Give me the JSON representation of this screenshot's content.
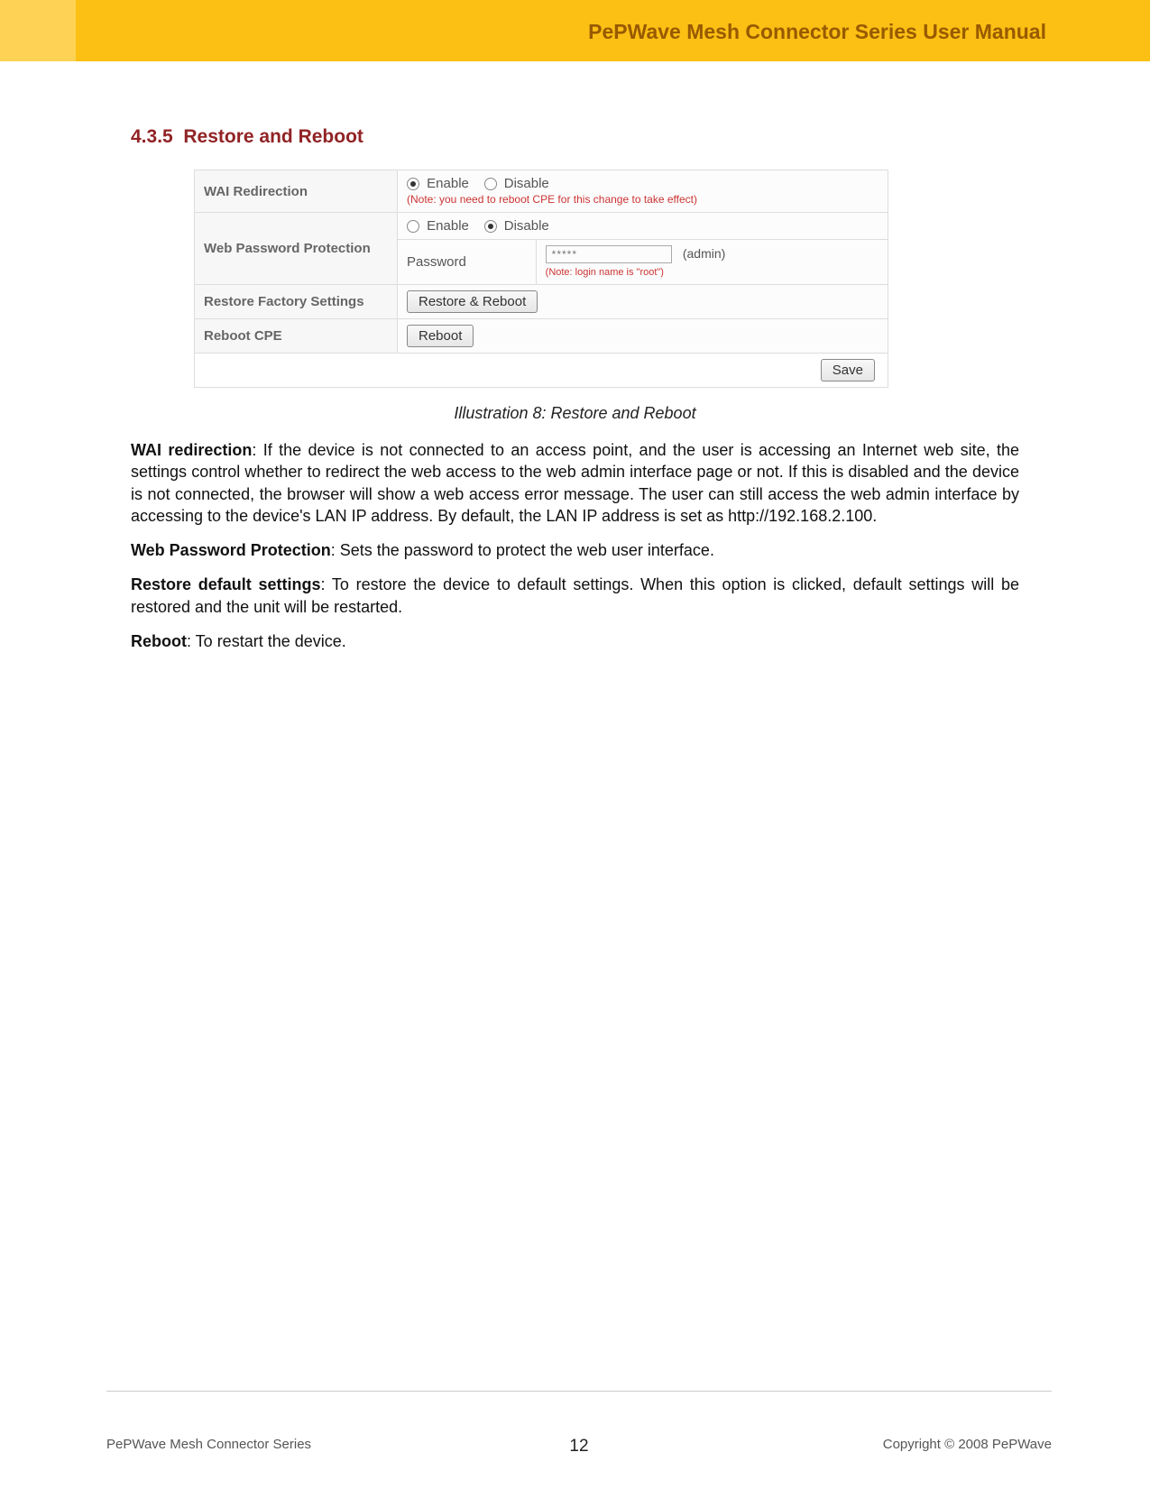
{
  "header": {
    "title": "PePWave Mesh Connector Series User Manual"
  },
  "section": {
    "number": "4.3.5",
    "title": "Restore and Reboot"
  },
  "table": {
    "wai_label": "WAI Redirection",
    "enable": "Enable",
    "disable": "Disable",
    "wai_note": "(Note: you need to reboot CPE for this change to take effect)",
    "webpw_label": "Web Password Protection",
    "password_label": "Password",
    "password_value": "*****",
    "admin_hint": "(admin)",
    "login_note": "(Note: login name is \"root\")",
    "restore_label": "Restore Factory Settings",
    "restore_btn": "Restore & Reboot",
    "reboot_label": "Reboot CPE",
    "reboot_btn": "Reboot",
    "save_btn": "Save"
  },
  "caption": "Illustration 8: Restore and Reboot",
  "paragraphs": {
    "p1_b": "WAI redirection",
    "p1": ": If the device is not connected to an access point, and the user is accessing an Internet web site, the settings control whether to redirect the web access to the web admin interface page or not.  If this is disabled and the device is not connected, the browser will show a web access error message.  The user can still access the web admin interface by accessing to the device's LAN IP address.  By default, the LAN IP address is set as http://192.168.2.100.",
    "p2_b": "Web Password Protection",
    "p2": ":  Sets the password to protect the web user interface.",
    "p3_b": "Restore default settings",
    "p3": ": To restore the device to default settings.  When this option is clicked, default settings will be restored and the unit will be restarted.",
    "p4_b": "Reboot",
    "p4": ": To restart the device."
  },
  "footer": {
    "left": "PePWave  Mesh Connector Series",
    "page": "12",
    "right": "Copyright © 2008 PePWave"
  }
}
